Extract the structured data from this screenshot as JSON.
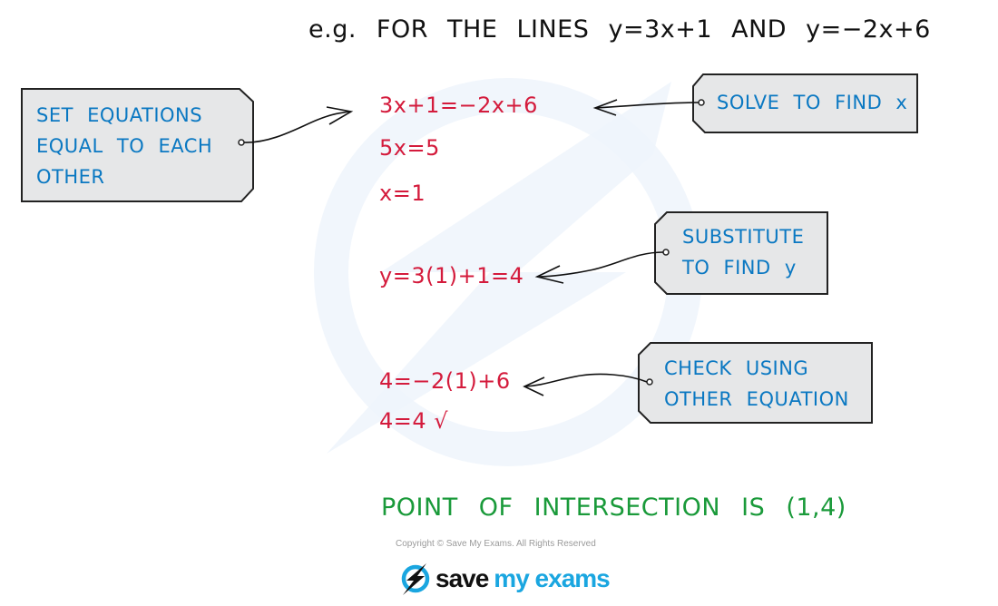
{
  "header": {
    "prefix": "e.g.",
    "text": "FOR THE LINES y=3x+1 AND y=−2x+6"
  },
  "colors": {
    "working": "#d41b3c",
    "annotation": "#0a78c2",
    "result": "#1a9a3a",
    "tag_fill": "#e6e7e8",
    "watermark": "#eef4fb",
    "brand": "#1aa6e0"
  },
  "working_steps": [
    "3x+1=−2x+6",
    "5x=5",
    "x=1",
    "y=3(1)+1=4",
    "4=−2(1)+6",
    "4=4 √"
  ],
  "annotations": [
    {
      "lines": [
        "SET EQUATIONS",
        "EQUAL TO EACH",
        "OTHER"
      ],
      "points_to": "3x+1=−2x+6"
    },
    {
      "lines": [
        "SOLVE TO FIND x"
      ],
      "points_to": "3x+1=−2x+6"
    },
    {
      "lines": [
        "SUBSTITUTE",
        "TO FIND y"
      ],
      "points_to": "y=3(1)+1=4"
    },
    {
      "lines": [
        "CHECK USING",
        "OTHER EQUATION"
      ],
      "points_to": "4=−2(1)+6"
    }
  ],
  "conclusion": "POINT OF INTERSECTION IS (1,4)",
  "footer": {
    "copyright": "Copyright © Save My Exams. All Rights Reserved",
    "logo_word1": "save",
    "logo_word2": "my exams"
  }
}
